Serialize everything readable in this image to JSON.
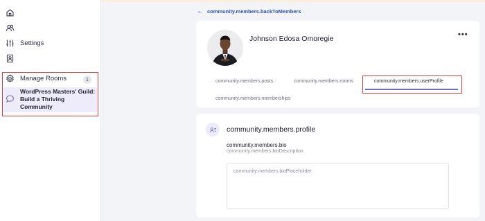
{
  "sidebar": {
    "settings_label": "Settings",
    "manage_rooms_label": "Manage Rooms",
    "manage_rooms_badge": "1",
    "room_title": "WordPress Masters' Guild: Build a Thriving Community"
  },
  "main": {
    "back_link": "community.members.backToMembers",
    "user": {
      "name": "Johnson Edosa Omoregie"
    },
    "more_icon": "more-horizontal-icon",
    "tabs": [
      {
        "label": "community.members.posts"
      },
      {
        "label": "community.members.rooms"
      },
      {
        "label": "community.members.userProfile",
        "active": true
      },
      {
        "label": "community.members.memberships"
      }
    ],
    "profile": {
      "title": "community.members.profile",
      "bio_label": "community.members.bio",
      "bio_description": "community.members.bioDescription",
      "bio_placeholder": "community.members.bioPlaceholder",
      "bio_value": ""
    }
  },
  "colors": {
    "accent": "#2b4fb8",
    "tab_indicator": "#6d6fbb",
    "highlight_box": "#e0393e",
    "active_room_bg": "#eeecfb"
  }
}
